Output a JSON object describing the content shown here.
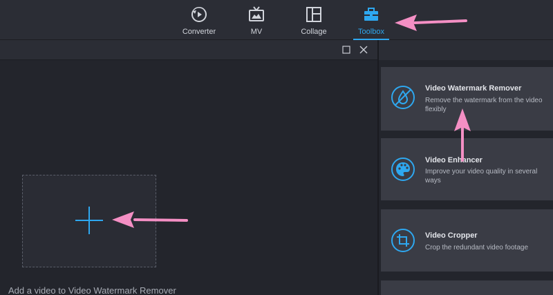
{
  "nav": {
    "items": [
      {
        "label": "Converter",
        "icon": "converter-icon"
      },
      {
        "label": "MV",
        "icon": "tv-icon"
      },
      {
        "label": "Collage",
        "icon": "collage-icon"
      },
      {
        "label": "Toolbox",
        "icon": "toolbox-icon"
      }
    ],
    "active": "Toolbox"
  },
  "workspace": {
    "drop_caption": "Add a video to Video Watermark Remover"
  },
  "tools": [
    {
      "title": "Video Watermark Remover",
      "description": "Remove the watermark from the video flexibly",
      "icon": "no-drop-icon"
    },
    {
      "title": "Video Enhancer",
      "description": "Improve your video quality in several ways",
      "icon": "palette-icon"
    },
    {
      "title": "Video Cropper",
      "description": "Crop the redundant video footage",
      "icon": "crop-icon"
    }
  ],
  "colors": {
    "accent": "#2ea8f0",
    "annotation_arrow": "#f48fc4",
    "background": "#23252c",
    "card": "#3a3c45"
  }
}
